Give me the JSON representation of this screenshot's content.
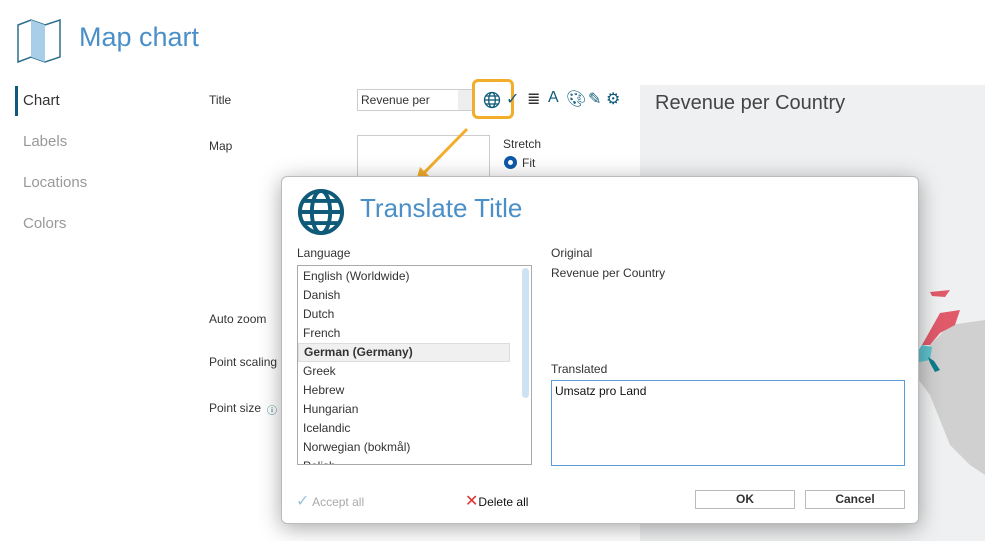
{
  "header": {
    "title": "Map chart",
    "icon": "map-icon"
  },
  "sidebar": {
    "items": [
      {
        "label": "Chart",
        "active": true
      },
      {
        "label": "Labels"
      },
      {
        "label": "Locations"
      },
      {
        "label": "Colors"
      }
    ]
  },
  "form": {
    "title_label": "Title",
    "title_value": "Revenue per",
    "map_label": "Map",
    "stretch_label": "Stretch",
    "stretch_option": "Fit",
    "auto_zoom_label": "Auto zoom",
    "point_scaling_label": "Point scaling",
    "point_size_label": "Point size"
  },
  "preview": {
    "title": "Revenue per Country",
    "colors": {
      "north": "#e05a6a",
      "central": "#5fc1cc",
      "italy": "#0c7d8c"
    }
  },
  "dialog": {
    "title": "Translate Title",
    "language_label": "Language",
    "languages": [
      "English (Worldwide)",
      "Danish",
      "Dutch",
      "French",
      "German (Germany)",
      "Greek",
      "Hebrew",
      "Hungarian",
      "Icelandic",
      "Norwegian (bokmål)",
      "Polish"
    ],
    "selected_language": "German (Germany)",
    "original_label": "Original",
    "original_value": "Revenue per Country",
    "translated_label": "Translated",
    "translated_value": "Umsatz pro Land",
    "accept_all": "Accept all",
    "delete_all": "Delete all",
    "ok": "OK",
    "cancel": "Cancel"
  },
  "accent": "#f2ad2a"
}
